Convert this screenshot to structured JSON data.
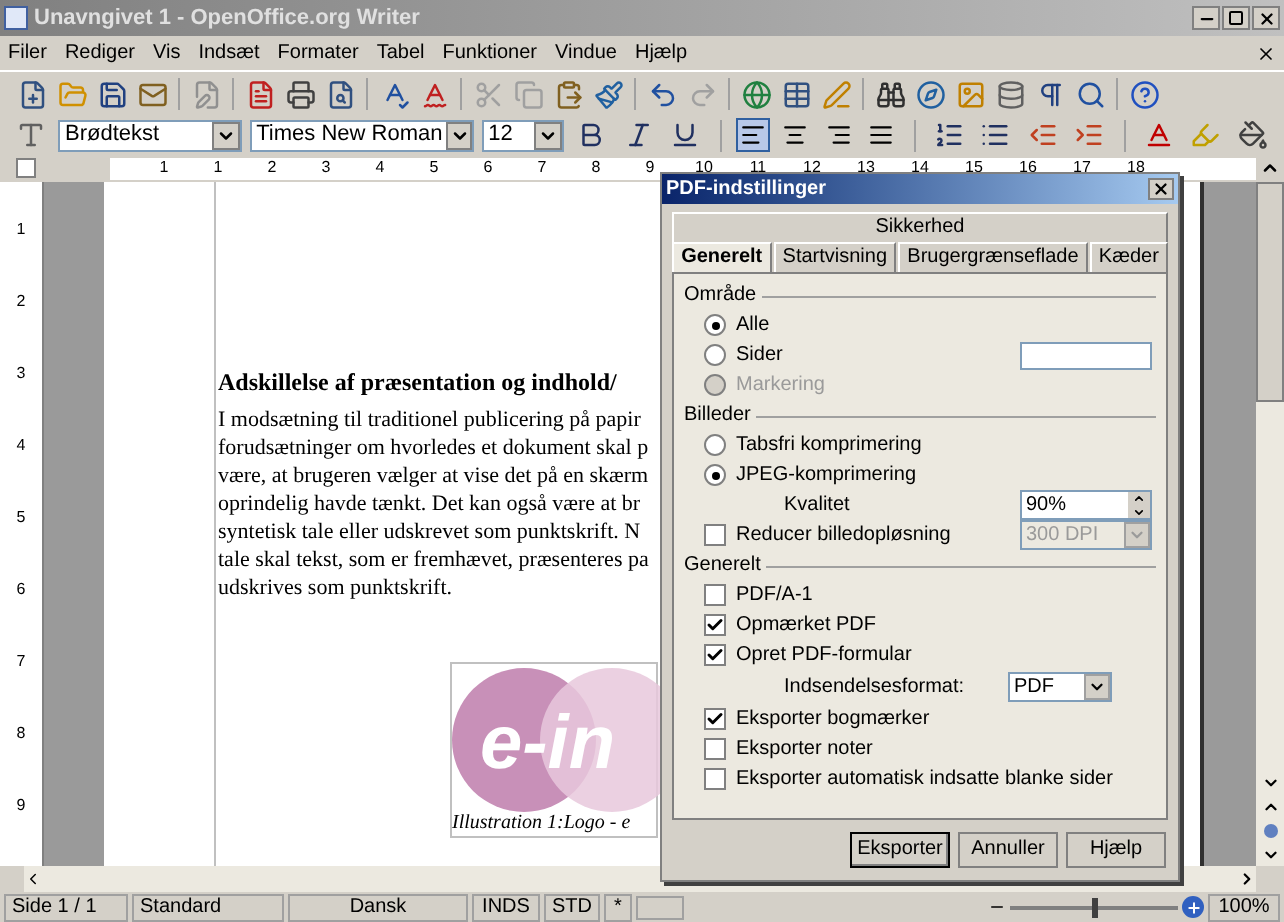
{
  "window": {
    "title": "Unavngivet 1 - OpenOffice.org Writer"
  },
  "menu": [
    "Filer",
    "Rediger",
    "Vis",
    "Indsæt",
    "Formater",
    "Tabel",
    "Funktioner",
    "Vindue",
    "Hjælp"
  ],
  "formatting": {
    "style": "Brødtekst",
    "font": "Times New Roman",
    "size": "12",
    "alignments": [
      {
        "kind": "left",
        "selected": true
      },
      {
        "kind": "center",
        "selected": false
      },
      {
        "kind": "right",
        "selected": false
      },
      {
        "kind": "justify",
        "selected": false
      }
    ]
  },
  "ruler": {
    "labels": [
      "1",
      "1",
      "2",
      "3",
      "4",
      "5",
      "6",
      "7",
      "8",
      "9",
      "10",
      "11",
      "12",
      "13",
      "14",
      "15",
      "16",
      "17",
      "18"
    ],
    "vertical_labels": [
      "1",
      "2",
      "3",
      "4",
      "5",
      "6",
      "7",
      "8",
      "9"
    ]
  },
  "document": {
    "heading": "Adskillelse af præsentation og indhold/",
    "lines": [
      "I modsætning til traditionel publicering på papir",
      "forudsætninger om hvorledes et dokument skal p",
      "være, at brugeren vælger at vise det på en skærm",
      "oprindelig havde tænkt. Det kan også være at br",
      "syntetisk tale eller udskrevet som punktskrift. N",
      "tale skal tekst, som er fremhævet, præsenteres pa",
      "udskrives som punktskrift."
    ],
    "logo_text": "e-in",
    "caption": "Illustration 1:Logo - e"
  },
  "dialog": {
    "title": "PDF-indstillinger",
    "tab_rows": [
      [
        {
          "label": "Sikkerhed",
          "selected": false
        }
      ],
      [
        {
          "label": "Generelt",
          "selected": true
        },
        {
          "label": "Startvisning",
          "selected": false
        },
        {
          "label": "Brugergrænseflade",
          "selected": false
        },
        {
          "label": "Kæder",
          "selected": false
        }
      ]
    ],
    "sections": [
      {
        "title": "Område",
        "items": [
          {
            "kind": "radio",
            "label": "Alle",
            "selected": true,
            "disabled": false
          },
          {
            "kind": "radio-field",
            "label": "Sider",
            "selected": false,
            "disabled": false
          },
          {
            "kind": "radio",
            "label": "Markering",
            "selected": false,
            "disabled": true
          }
        ]
      },
      {
        "title": "Billeder",
        "items": [
          {
            "kind": "radio",
            "label": "Tabsfri komprimering",
            "selected": false,
            "disabled": false
          },
          {
            "kind": "radio",
            "label": "JPEG-komprimering",
            "selected": true,
            "disabled": false
          },
          {
            "kind": "spin",
            "label": "Kvalitet",
            "value": "90%"
          },
          {
            "kind": "checkbox-select",
            "label": "Reducer billedopløsning",
            "checked": false,
            "value": "300 DPI",
            "disabled": true
          }
        ]
      },
      {
        "title": "Generelt",
        "items": [
          {
            "kind": "checkbox",
            "label": "PDF/A-1",
            "checked": false
          },
          {
            "kind": "checkbox",
            "label": "Opmærket PDF",
            "checked": true
          },
          {
            "kind": "checkbox",
            "label": "Opret PDF-formular",
            "checked": true
          },
          {
            "kind": "select",
            "label": "Indsendelsesformat:",
            "value": "PDF",
            "disabled": false
          },
          {
            "kind": "checkbox",
            "label": "Eksporter bogmærker",
            "checked": true
          },
          {
            "kind": "checkbox",
            "label": "Eksporter noter",
            "checked": false
          },
          {
            "kind": "checkbox",
            "label": "Eksporter automatisk indsatte blanke sider",
            "checked": false
          }
        ]
      }
    ],
    "buttons": [
      {
        "label": "Eksporter",
        "default": true
      },
      {
        "label": "Annuller",
        "default": false
      },
      {
        "label": "Hjælp",
        "default": false
      }
    ]
  },
  "status_bar": {
    "page": "Side 1 / 1",
    "style": "Standard",
    "language": "Dansk",
    "mode": "INDS",
    "selection": "STD",
    "modified": "*",
    "zoom_slider": {
      "level": 0.5
    },
    "zoom": "100%"
  }
}
